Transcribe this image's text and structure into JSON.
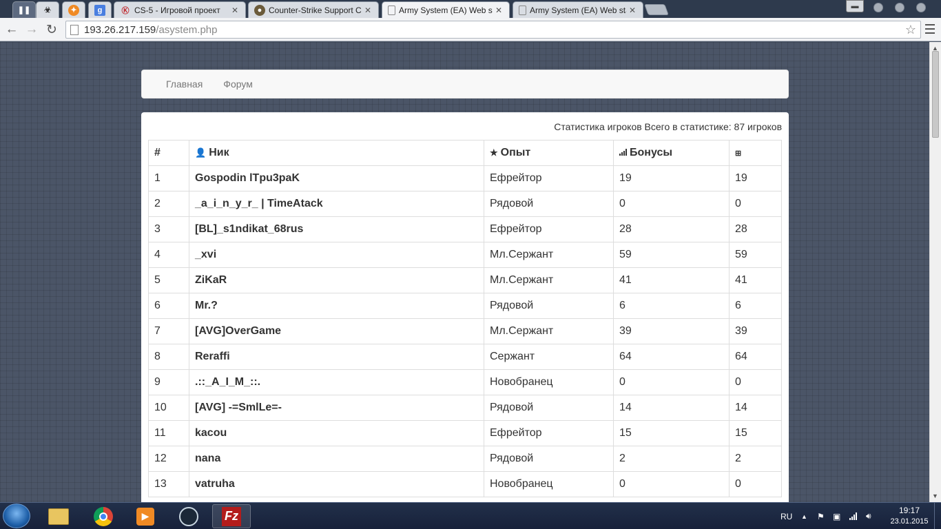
{
  "browser": {
    "tabs": [
      {
        "title": "",
        "favicon": "hazard-icon"
      },
      {
        "title": "",
        "favicon": "flame-icon"
      },
      {
        "title": "",
        "favicon": "google-icon"
      },
      {
        "title": "CS-5 - Игровой проект",
        "favicon": "cs5-icon"
      },
      {
        "title": "Counter-Strike Support Co",
        "favicon": "cs-support-icon"
      },
      {
        "title": "Army System (EA) Web sta",
        "favicon": "page-icon",
        "active": true
      },
      {
        "title": "Army System (EA) Web sta",
        "favicon": "page-icon"
      }
    ],
    "url_host": "193.26.217.159",
    "url_path": "/asystem.php"
  },
  "navbar": {
    "items": [
      "Главная",
      "Форум"
    ]
  },
  "stats": {
    "caption": "Статистика игроков Всего в статистике: 87 игроков",
    "headers": {
      "num": "#",
      "nick": "Ник",
      "xp": "Опыт",
      "bonus": "Бонусы",
      "gift": ""
    },
    "rows": [
      {
        "num": "1",
        "nick": "Gospodin lTpu3paK",
        "rank": "Ефрейтор",
        "bonus": "19",
        "gift": "19"
      },
      {
        "num": "2",
        "nick": "_a_i_n_y_r_ | TimeAtack",
        "rank": "Рядовой",
        "bonus": "0",
        "gift": "0"
      },
      {
        "num": "3",
        "nick": "[BL]_s1ndikat_68rus",
        "rank": "Ефрейтор",
        "bonus": "28",
        "gift": "28"
      },
      {
        "num": "4",
        "nick": "_xvi",
        "rank": "Мл.Сержант",
        "bonus": "59",
        "gift": "59"
      },
      {
        "num": "5",
        "nick": "ZiKaR",
        "rank": "Мл.Сержант",
        "bonus": "41",
        "gift": "41"
      },
      {
        "num": "6",
        "nick": "Mr.?",
        "rank": "Рядовой",
        "bonus": "6",
        "gift": "6"
      },
      {
        "num": "7",
        "nick": "[AVG]OverGame",
        "rank": "Мл.Сержант",
        "bonus": "39",
        "gift": "39"
      },
      {
        "num": "8",
        "nick": "Reraffi",
        "rank": "Сержант",
        "bonus": "64",
        "gift": "64"
      },
      {
        "num": "9",
        "nick": ".::_A_I_M_::.",
        "rank": "Новобранец",
        "bonus": "0",
        "gift": "0"
      },
      {
        "num": "10",
        "nick": "[AVG] -=SmlLe=-",
        "rank": "Рядовой",
        "bonus": "14",
        "gift": "14"
      },
      {
        "num": "11",
        "nick": "kacou",
        "rank": "Ефрейтор",
        "bonus": "15",
        "gift": "15"
      },
      {
        "num": "12",
        "nick": "nana",
        "rank": "Рядовой",
        "bonus": "2",
        "gift": "2"
      },
      {
        "num": "13",
        "nick": "vatruha",
        "rank": "Новобранец",
        "bonus": "0",
        "gift": "0"
      }
    ]
  },
  "taskbar": {
    "apps": [
      "windows-explorer-icon",
      "chrome-icon",
      "media-player-icon",
      "steam-icon",
      "filezilla-icon"
    ],
    "language": "RU",
    "time": "19:17",
    "date": "23.01.2015"
  }
}
